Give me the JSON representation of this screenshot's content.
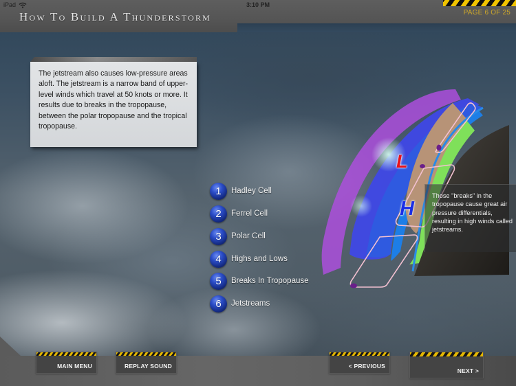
{
  "status_bar": {
    "device": "iPad",
    "time": "3:10 PM",
    "wifi_icon": "wifi-icon"
  },
  "header": {
    "title": "How To Build A Thunderstorm",
    "page_indicator": "PAGE 6 OF 25",
    "accent_color": "#d1a928"
  },
  "info_panel": {
    "text": "The jetstream also causes low-pressure areas aloft.  The jetstream is a narrow band of upper-level winds which travel at 50 knots or more.  It results due to breaks in the tropopause, between the polar tropopause and the tropical tropopause."
  },
  "menu": {
    "items": [
      {
        "number": "1",
        "label": "Hadley Cell"
      },
      {
        "number": "2",
        "label": "Ferrel Cell"
      },
      {
        "number": "3",
        "label": "Polar Cell"
      },
      {
        "number": "4",
        "label": "Highs and Lows"
      },
      {
        "number": "5",
        "label": "Breaks In Tropopause"
      },
      {
        "number": "6",
        "label": "Jetstreams"
      }
    ]
  },
  "diagram": {
    "low_label": "L",
    "high_label": "H",
    "low_color": "#e8121c",
    "high_color": "#1a2ee6",
    "callout": "Those \"breaks\" in the tropopause cause great air pressure differentials, resulting in high winds called jetstreams."
  },
  "footer": {
    "main_menu": "MAIN MENU",
    "replay_sound": "REPLAY SOUND",
    "previous": "< PREVIOUS",
    "next": "NEXT >"
  }
}
